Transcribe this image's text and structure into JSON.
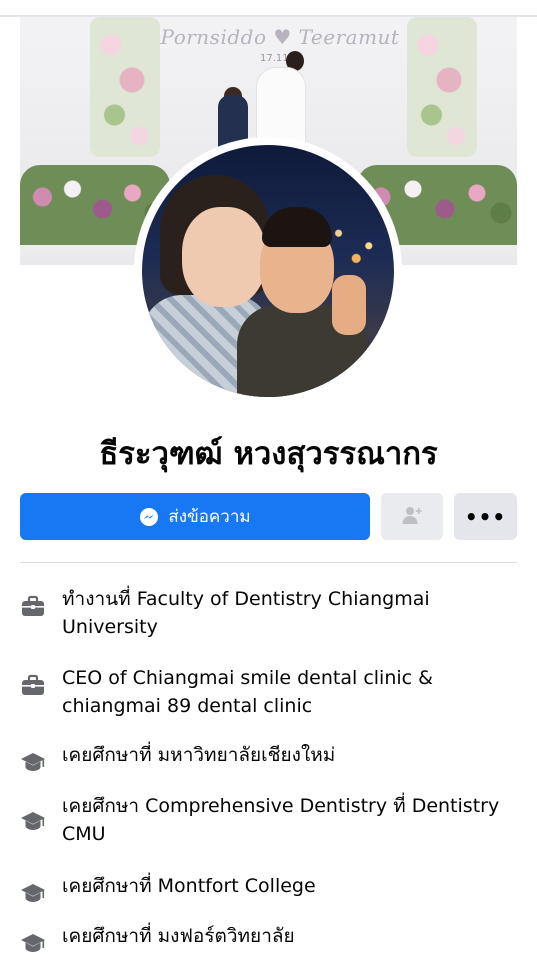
{
  "cover": {
    "title": "Pornsiddo ♥ Teeramut",
    "date": "17.11"
  },
  "profile": {
    "name": "ธีระวุฑฒ์ หวงสุวรรณากร"
  },
  "actions": {
    "message_label": "ส่งข้อความ",
    "more_label": "•••"
  },
  "info": [
    {
      "icon": "briefcase-icon",
      "text": "ทำงานที่ Faculty of Dentistry Chiangmai University"
    },
    {
      "icon": "briefcase-icon",
      "text": "CEO of Chiangmai smile dental clinic & chiangmai 89 dental clinic"
    },
    {
      "icon": "graduation-cap-icon",
      "text": "เคยศึกษาที่ มหาวิทยาลัยเชียงใหม่"
    },
    {
      "icon": "graduation-cap-icon",
      "text": "เคยศึกษา Comprehensive Dentistry ที่ Dentistry CMU"
    },
    {
      "icon": "graduation-cap-icon",
      "text": "เคยศึกษาที่ Montfort College"
    },
    {
      "icon": "graduation-cap-icon",
      "text": "เคยศึกษาที่ มงฟอร์ตวิทยาลัย"
    }
  ],
  "colors": {
    "primary_button": "#1877f2",
    "secondary_button": "#e4e6eb",
    "icon_gray": "#65676b"
  }
}
